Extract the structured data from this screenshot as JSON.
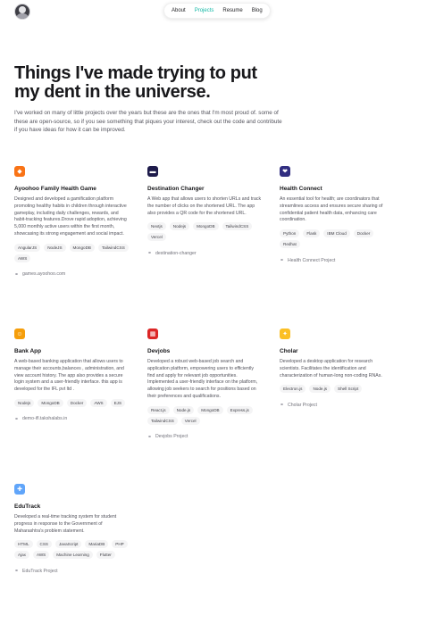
{
  "nav": {
    "items": [
      "About",
      "Projects",
      "Resume",
      "Blog"
    ],
    "active": "Projects",
    "accent": "#14b8a6"
  },
  "hero": {
    "title": "Things I've made trying to put my dent in the universe.",
    "intro": "I've worked on many of little projects over the years but these are the ones that I'm most proud of. some of these are open-source, so if you see something that piques your interest, check out the code and contribute if you have ideas for how it can be improved."
  },
  "projects": [
    {
      "title": "Ayoohoo Family Health Game",
      "icon": "game-logo-icon",
      "logo_color": "#f97316",
      "description": "Designed and developed a gamification platform promoting healthy habits in children through interactive gameplay, including daily challenges, rewards, and habit-tracking features.Drove rapid adoption, achieving 5,000 monthly active users within the first month, showcasing its strong engagement and social impact.",
      "tags": [
        "AngularJS",
        "NodeJS",
        "MongoDB",
        "TailwindCSS",
        "AWS"
      ],
      "link": "games.ayoohoo.com"
    },
    {
      "title": "Destination Changer",
      "icon": "url-logo-icon",
      "logo_color": "#1e1b4b",
      "description": "A Web app that allows users to shorten URLs and track the number of clicks on the shortened URL. The app also provides a QR code for the shortened URL.",
      "tags": [
        "Nextjs",
        "Nodejs",
        "MongoDB",
        "TailwindCSS",
        "Vercel"
      ],
      "link": "destination-changer"
    },
    {
      "title": "Health Connect",
      "icon": "heart-logo-icon",
      "logo_color": "#312e81",
      "description": "An essential tool for health; are coordinators that streamlines access and ensures secure sharing of confidential patient health data, enhancing care coordination.",
      "tags": [
        "Python",
        "Flask",
        "IBM Cloud",
        "Docker",
        "Redhat"
      ],
      "link": "Health Connect Project"
    },
    {
      "title": "Bank App",
      "icon": "bank-logo-icon",
      "logo_color": "#f59e0b",
      "description": "A web-based banking application that allows users to manage their accounts,balances , administration, and view account history. The app also provides a secure login system and a user-friendly interface. this app is developed for the IFL pvt ltd .",
      "tags": [
        "Nodejs",
        "MongoDB",
        "Docker",
        "AWS",
        "EJS"
      ],
      "link": "demo-ifl.takshalabs.in"
    },
    {
      "title": "Devjobs",
      "icon": "jobs-logo-icon",
      "logo_color": "#dc2626",
      "description": "Developed a robust web-based job search and application platform, empowering users to efficiently find and apply for relevant job opportunities. Implemented a user-friendly interface on the platform, allowing job seekers to search for positions based on their preferences and qualifications.",
      "tags": [
        "React.js",
        "Node.js",
        "MongoDB",
        "Express.js",
        "TailwindCSS",
        "Vercel"
      ],
      "link": "Devjobs Project"
    },
    {
      "title": "Cholar",
      "icon": "research-logo-icon",
      "logo_color": "#fbbf24",
      "description": "Developed a desktop application for research scientists. Facilitates the identification and characterization of human-long non-coding RNAs.",
      "tags": [
        "Electron.js",
        "Node.js",
        "Shell Script"
      ],
      "link": "Cholar Project"
    },
    {
      "title": "EduTrack",
      "icon": "edu-logo-icon",
      "logo_color": "#60a5fa",
      "description": "Developed a real-time tracking system for student progress in response to the Government of Maharashtra's problem statement.",
      "tags": [
        "HTML",
        "CSS",
        "JavaScript",
        "MariaDB",
        "PHP",
        "Ajax",
        "AWS",
        "Machine Learning",
        "Flutter"
      ],
      "link": "EduTrack Project"
    }
  ]
}
